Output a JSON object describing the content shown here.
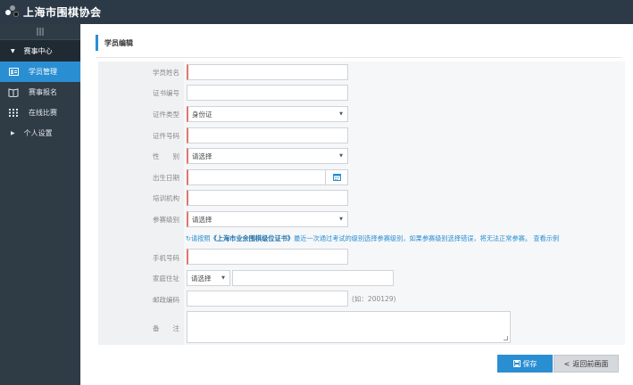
{
  "app": {
    "title": "上海市围棋协会",
    "logo_icon": "go-stones-logo"
  },
  "sidebar": {
    "collapse_icon": "menu-bars-icon",
    "group_label": "赛事中心",
    "items": [
      {
        "label": "学员管理",
        "icon": "id-card-icon",
        "active": true
      },
      {
        "label": "赛事报名",
        "icon": "book-icon",
        "active": false
      },
      {
        "label": "在线比赛",
        "icon": "grid-icon",
        "active": false
      }
    ],
    "settings_label": "个人设置"
  },
  "page": {
    "title": "学员编辑"
  },
  "form": {
    "name_label": "学员姓名",
    "name_value": "",
    "cert_no_label": "证书编号",
    "cert_no_value": "",
    "id_type_label": "证件类型",
    "id_type_value": "身份证",
    "id_no_label": "证件号码",
    "id_no_value": "",
    "gender_label": "性　　别",
    "gender_value": "请选择",
    "birth_label": "出生日期",
    "birth_value": "",
    "org_label": "培训机构",
    "org_value": "",
    "level_label": "参赛级别",
    "level_value": "请选择",
    "tip_prefix": "请按照",
    "tip_book": "《上海市业余围棋级位证书》",
    "tip_text": "最近一次通过考试的级别选择参赛级别，如果参赛级别选择错误，将无法正常参赛。",
    "tip_link": "查看示例",
    "phone_label": "手机号码",
    "phone_value": "",
    "address_label": "家庭住址",
    "address_select_value": "请选择",
    "address_value": "",
    "zip_label": "邮政编码",
    "zip_value": "",
    "zip_hint": "(如：200129)",
    "remark_label": "备　　注",
    "remark_value": ""
  },
  "buttons": {
    "save": "保存",
    "back": "返回前画面"
  },
  "colors": {
    "accent": "#2a8ed2",
    "topbar": "#2c3a47",
    "sidebar": "#2f3b45",
    "required": "#e0766e"
  }
}
